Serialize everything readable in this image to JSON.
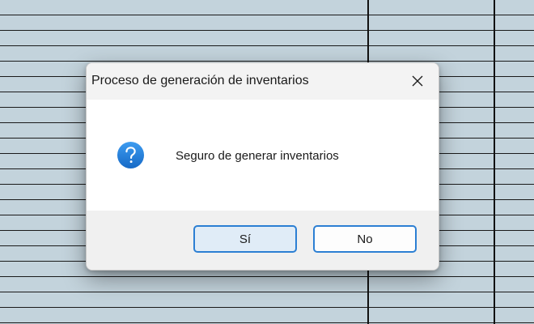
{
  "dialog": {
    "title": "Proceso de generación de inventarios",
    "message": "Seguro de generar inventarios",
    "icon": "question-icon",
    "buttons": {
      "yes_label": "Sí",
      "no_label": "No"
    },
    "close_icon": "close-icon"
  },
  "colors": {
    "accent": "#2c7fd3",
    "icon_blue": "#1e7bd6",
    "background_grid": "#c3d3dc"
  }
}
